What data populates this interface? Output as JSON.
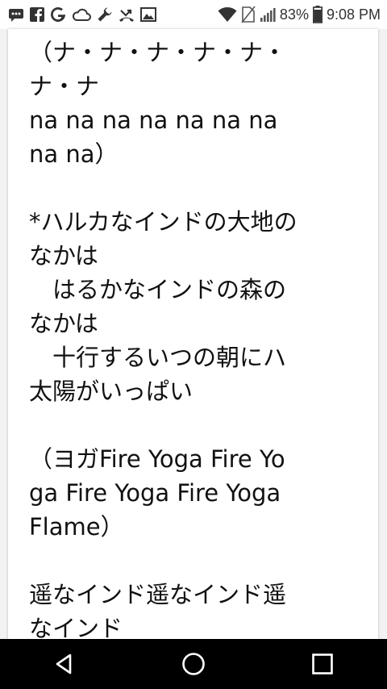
{
  "status_bar": {
    "icons_left": [
      "messages-icon",
      "facebook-icon",
      "google-icon",
      "cloud-icon",
      "wrench-icon",
      "missed-call-icon",
      "gallery-icon"
    ],
    "icons_right": [
      "wifi-icon",
      "no-sim-icon",
      "signal-icon",
      "battery-icon"
    ],
    "battery_percent": "83%",
    "time": "9:08 PM"
  },
  "content": {
    "lyrics_text": "（ナ・ナ・ナ・ナ・ナ・ナ・ナ\nna na na na na na na na na）\n\n*ハルカなインドの大地のなかは\n　はるかなインドの森のなかは\n　十行するいつの朝にハ太陽がいっぱい\n\n（ヨガFire Yoga Fire Yoga Fire Yoga Fire Yoga Flame）\n\n遥なインド遥なインド遥なインド"
  },
  "nav_bar": {
    "buttons": [
      "back-button",
      "home-button",
      "recents-button"
    ]
  },
  "colors": {
    "status_bar_bg": "#ffffff",
    "nav_bar_bg": "#000000",
    "text": "#111111"
  }
}
